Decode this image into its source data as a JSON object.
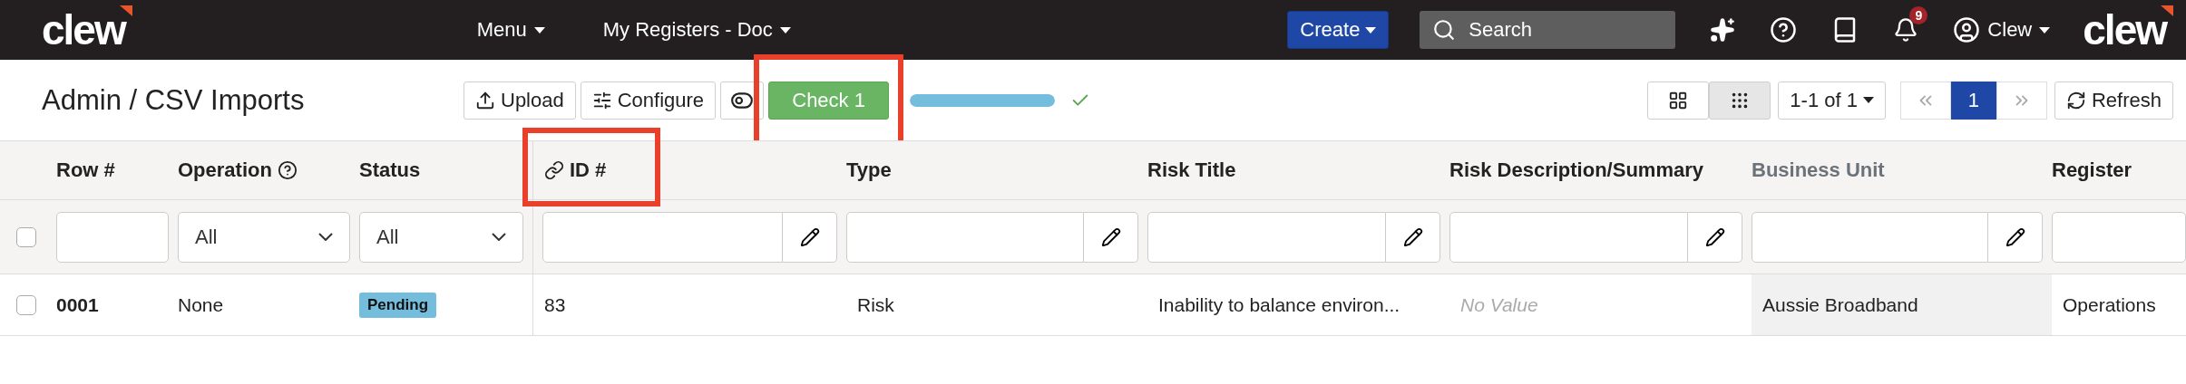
{
  "topbar": {
    "logo": "clew",
    "nav": [
      {
        "label": "Menu"
      },
      {
        "label": "My Registers - Doc"
      }
    ],
    "create": "Create",
    "search": {
      "placeholder": "Search"
    },
    "notifications": "9",
    "user": "Clew",
    "logo_right": "clew"
  },
  "toolbar": {
    "title": "Admin / CSV Imports",
    "buttons": [
      {
        "label": "Upload",
        "kind": "upload"
      },
      {
        "label": "Configure",
        "kind": "configure"
      }
    ],
    "check": {
      "label": "Check 1",
      "highlighted": true
    },
    "progress": {
      "level": 1,
      "complete": true
    },
    "views": [
      {
        "kind": "cards",
        "selected": false
      },
      {
        "kind": "grid",
        "selected": true
      }
    ],
    "range": "1-1 of 1",
    "pages": [
      {
        "label": "1",
        "selected": true
      }
    ],
    "refresh": "Refresh"
  },
  "table": {
    "select_all_checked": false,
    "columns": [
      {
        "label": "Row #",
        "filter": {
          "kind": "input"
        }
      },
      {
        "label": "Operation",
        "help": true,
        "filter": {
          "kind": "select",
          "value": "All"
        }
      },
      {
        "label": "Status",
        "filter": {
          "kind": "select",
          "value": "All"
        }
      },
      {
        "label": "ID #",
        "link": true,
        "highlighted": true,
        "filter": {
          "kind": "edit"
        }
      },
      {
        "label": "Type",
        "filter": {
          "kind": "edit"
        }
      },
      {
        "label": "Risk Title",
        "filter": {
          "kind": "edit"
        }
      },
      {
        "label": "Risk Description/Summary",
        "filter": {
          "kind": "edit"
        }
      },
      {
        "label": "Business Unit",
        "readonly": true,
        "filter": {
          "kind": "edit"
        }
      },
      {
        "label": "Register",
        "filter": {
          "kind": "input"
        }
      }
    ],
    "rows": [
      {
        "checked": false,
        "cells": [
          {
            "text": "0001",
            "kind": "bold"
          },
          {
            "text": "None",
            "kind": "plain"
          },
          {
            "text": "Pending",
            "kind": "badge"
          },
          {
            "text": "83",
            "kind": "plain"
          },
          {
            "text": "Risk",
            "kind": "plain"
          },
          {
            "text": "Inability to balance environ...",
            "kind": "plain"
          },
          {
            "text": "No Value",
            "kind": "empty"
          },
          {
            "text": "Aussie Broadband",
            "kind": "plain"
          },
          {
            "text": "Operations",
            "kind": "plain"
          }
        ]
      }
    ]
  }
}
